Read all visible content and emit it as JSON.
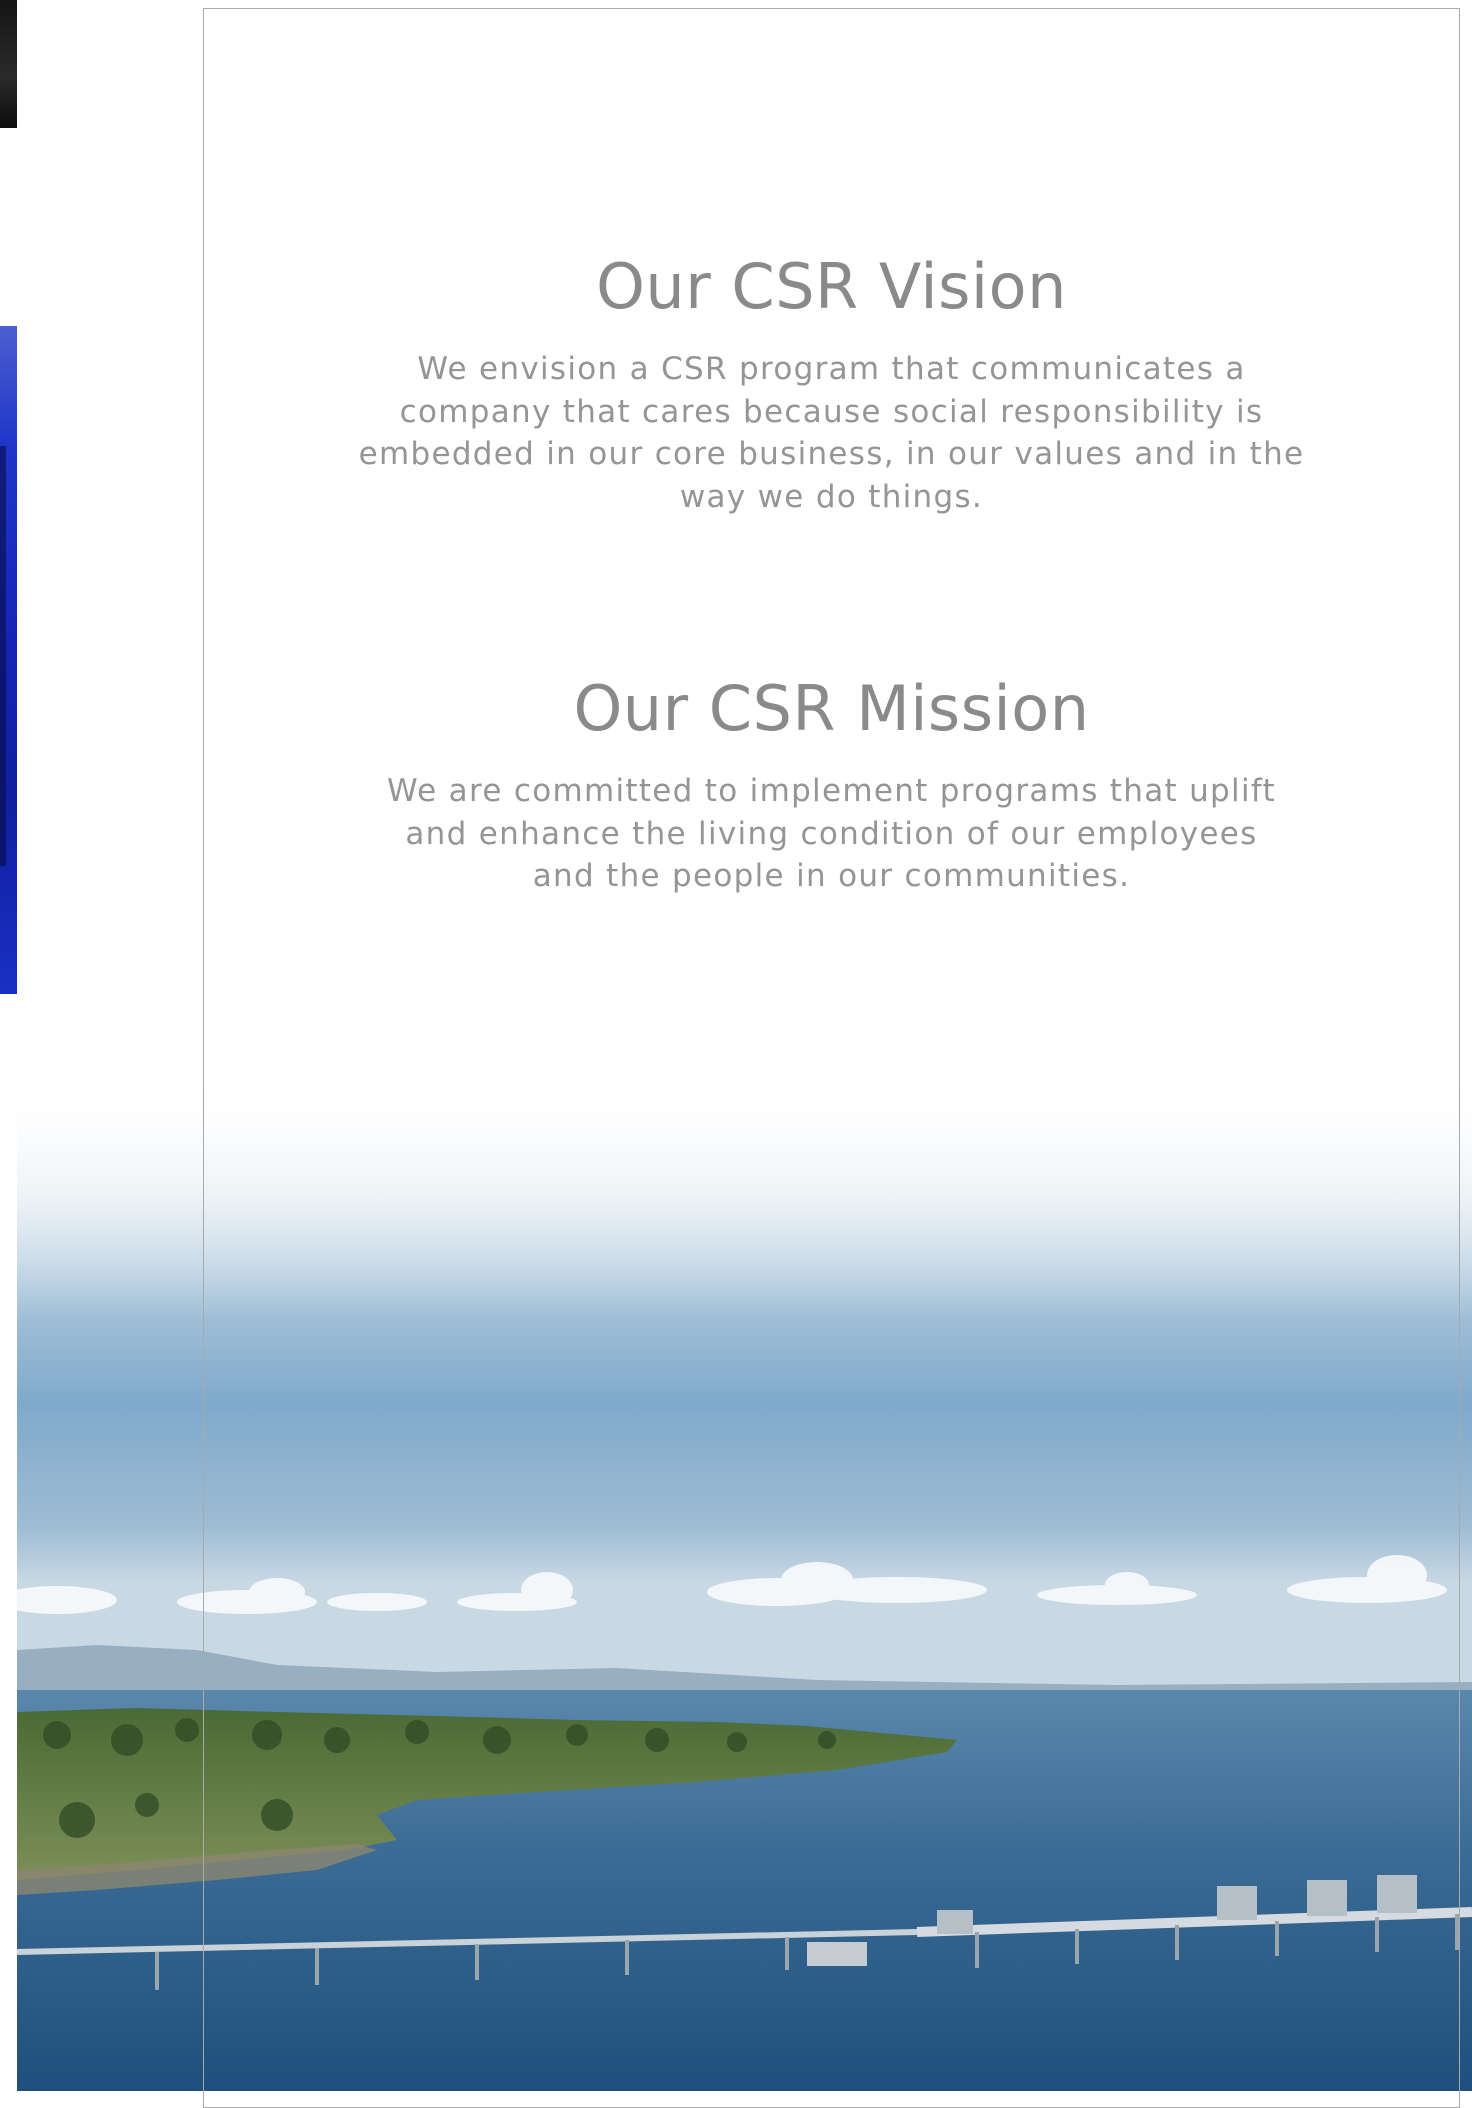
{
  "vision": {
    "heading": "Our CSR Vision",
    "body": "We envision a CSR program that communicates a company that cares because social responsibility is embedded in our core business, in our values and in the way we do things."
  },
  "mission": {
    "heading": "Our CSR Mission",
    "body": "We are committed to implement programs that uplift and enhance the living condition of our employees and the people in our communities."
  },
  "colors": {
    "text": "#8f8f8f",
    "frame": "#a9a9a9",
    "sky_top": "#dfe8ef",
    "sky_mid": "#8fb5d3",
    "sea": "#2f5f86",
    "land": "#5e7d3c"
  }
}
